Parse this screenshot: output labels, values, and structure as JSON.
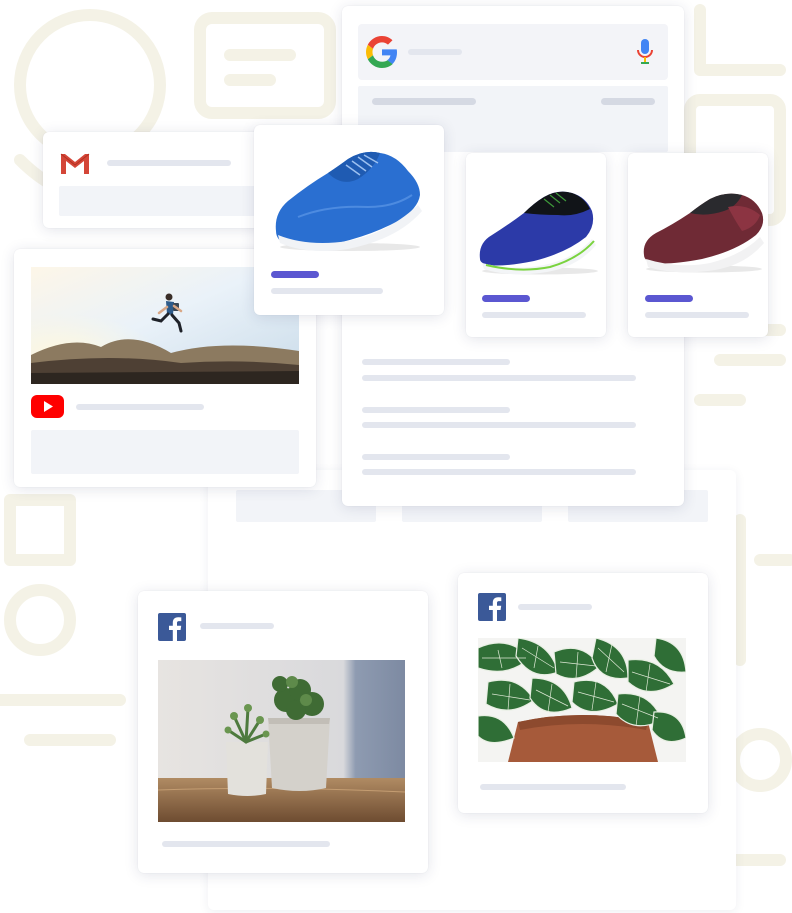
{
  "colors": {
    "accent": "#5b57d1",
    "placeholder": "#e3e6ee",
    "placeholder_block": "#f2f4f8",
    "google_blue": "#4285f4",
    "google_red": "#ea4335",
    "google_yellow": "#fbbc05",
    "google_green": "#34a853",
    "gmail_red": "#d44638",
    "youtube_red": "#ff0000",
    "facebook_blue": "#3b5998",
    "background_line": "#f3f1e4"
  },
  "icons": {
    "google": "google-logo-icon",
    "microphone": "microphone-icon",
    "gmail": "gmail-logo-icon",
    "youtube": "youtube-logo-icon",
    "facebook": "facebook-logo-icon"
  },
  "images": {
    "running_man": "photo-running-man",
    "blue_shoe": "photo-blue-sneaker",
    "dark_blue_shoe": "photo-dark-blue-sneaker",
    "maroon_shoe": "photo-maroon-sneaker",
    "succulents": "photo-succulent-pots",
    "fittonia": "photo-fittonia-plant"
  }
}
